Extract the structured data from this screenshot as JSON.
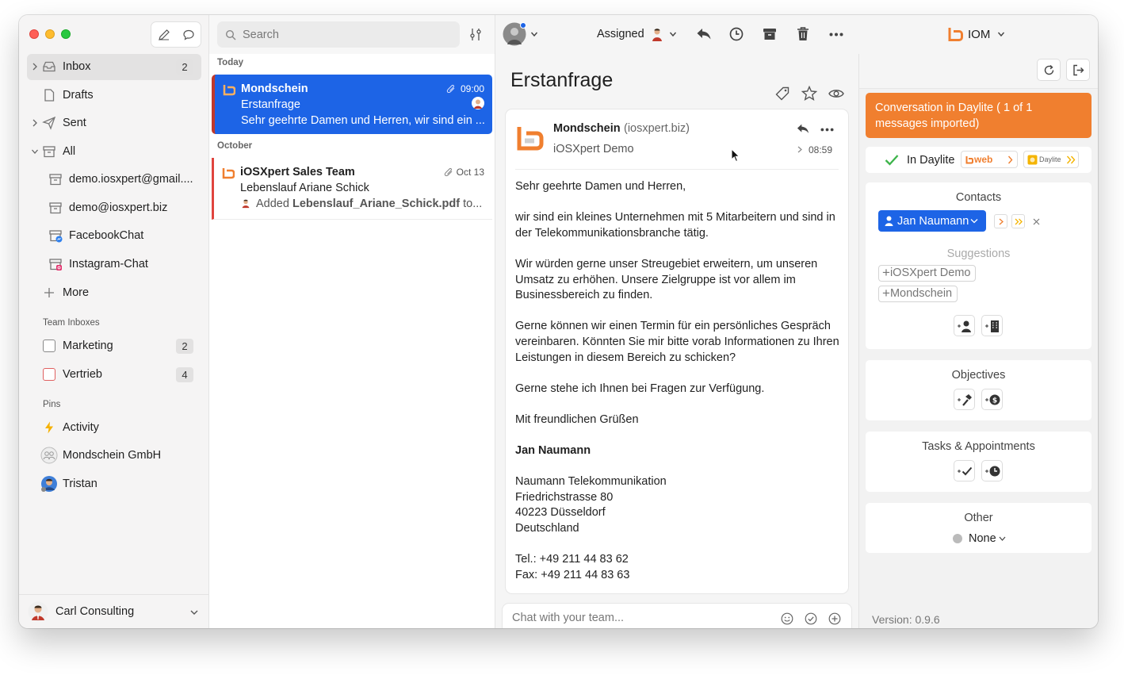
{
  "colors": {
    "accent_blue": "#1d64e6",
    "orange": "#f07f2f",
    "selected_marker": "#c0392b",
    "green_check": "#3cb44a"
  },
  "sidebar": {
    "items": [
      {
        "label": "Inbox",
        "count": "2",
        "icon": "inbox-icon"
      },
      {
        "label": "Drafts",
        "icon": "draft-icon"
      },
      {
        "label": "Sent",
        "icon": "paper-plane-icon"
      },
      {
        "label": "All",
        "icon": "archive-box-icon"
      },
      {
        "label": "demo.iosxpert@gmail....",
        "icon": "mailbox-icon"
      },
      {
        "label": "demo@iosxpert.biz",
        "icon": "mailbox-icon"
      },
      {
        "label": "FacebookChat",
        "icon": "messenger-icon"
      },
      {
        "label": "Instagram-Chat",
        "icon": "instagram-icon"
      },
      {
        "label": "More",
        "icon": "plus-icon"
      }
    ],
    "team_title": "Team Inboxes",
    "team": [
      {
        "label": "Marketing",
        "count": "2"
      },
      {
        "label": "Vertrieb",
        "count": "4"
      }
    ],
    "pins_title": "Pins",
    "pins": [
      {
        "label": "Activity",
        "icon": "lightning-icon"
      },
      {
        "label": "Mondschein GmbH",
        "icon": "group-icon"
      },
      {
        "label": "Tristan",
        "icon": "avatar"
      }
    ],
    "account": "Carl Consulting"
  },
  "search": {
    "placeholder": "Search"
  },
  "list": {
    "groups": [
      "Today",
      "October"
    ],
    "conversations": [
      {
        "title": "Mondschein",
        "subject": "Erstanfrage",
        "preview": "Sehr geehrte Damen und Herren, wir sind ein ...",
        "time": "09:00"
      },
      {
        "title": "iOSXpert Sales Team",
        "subject": "Lebenslauf Ariane Schick",
        "preview_prefix": "Added ",
        "preview_bold": "Lebenslauf_Ariane_Schick.pdf",
        "preview_suffix": " to...",
        "time": "Oct 13"
      }
    ]
  },
  "toolbar": {
    "assigned_label": "Assigned",
    "brand_label": "IOM"
  },
  "message": {
    "subject": "Erstanfrage",
    "from_name": "Mondschein",
    "from_domain": "(iosxpert.biz)",
    "to": "iOSXpert Demo",
    "time": "08:59",
    "body": {
      "greeting": "Sehr geehrte Damen und Herren,",
      "p1": "wir sind ein kleines Unternehmen mit 5 Mitarbeitern und sind in der Telekommunikationsbranche tätig.",
      "p2": "Wir würden gerne unser Streugebiet erweitern, um unseren Umsatz zu erhöhen. Unsere Zielgruppe ist vor allem im Businessbereich zu finden.",
      "p3": "Gerne können wir einen Termin für ein persönliches Gespräch vereinbaren. Könnten Sie mir bitte vorab Informationen zu Ihren Leistungen in diesem Bereich zu schicken?",
      "p4": "Gerne stehe ich Ihnen bei Fragen zur Verfügung.",
      "p5": "Mit freundlichen Grüßen",
      "signature_name": "Jan Naumann",
      "company": "Naumann Telekommunikation",
      "street": "Friedrichstrasse 80",
      "city": "40223 Düsseldorf",
      "country": "Deutschland",
      "tel": "Tel.: +49 211 44 83 62",
      "fax": "Fax: +49 211 44 83 63"
    }
  },
  "chat": {
    "placeholder": "Chat with your team..."
  },
  "panel": {
    "banner": "Conversation in Daylite ( 1 of 1 messages imported)",
    "in_daylite": "In Daylite",
    "web_label": "web",
    "daylite_label": "Daylite",
    "contacts_title": "Contacts",
    "contact": "Jan Naumann",
    "suggestions_title": "Suggestions",
    "suggestions": [
      "iOSXpert Demo",
      "Mondschein"
    ],
    "objectives_title": "Objectives",
    "tasks_title": "Tasks & Appointments",
    "other_title": "Other",
    "other_value": "None",
    "version": "Version: 0.9.6"
  }
}
